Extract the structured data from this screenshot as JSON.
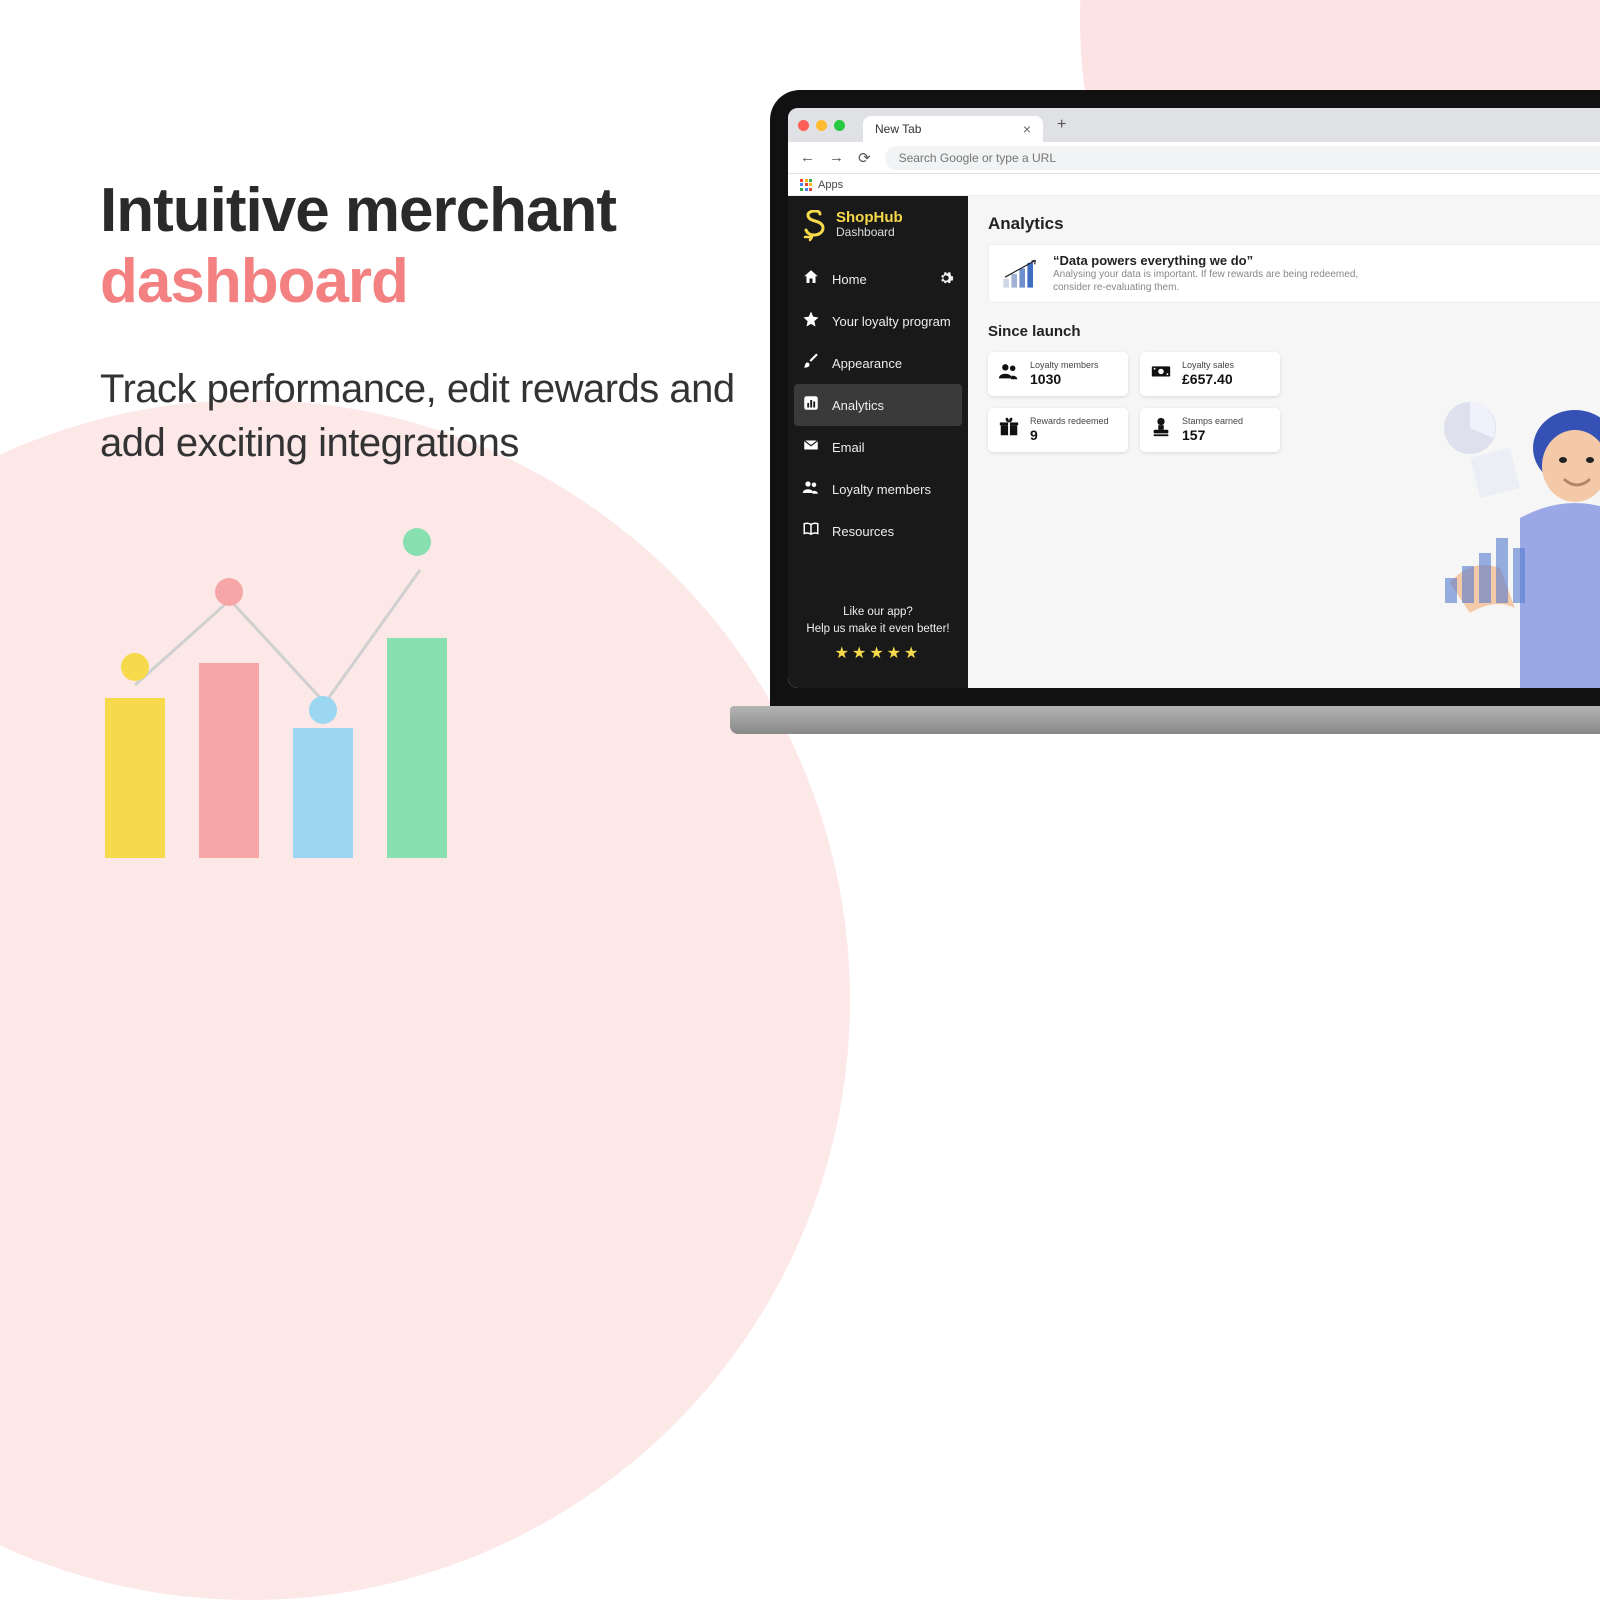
{
  "hero": {
    "title_line1": "Intuitive merchant",
    "title_line2": "dashboard",
    "subtitle": "Track performance, edit rewards and add exciting integrations"
  },
  "browser": {
    "tab_title": "New Tab",
    "new_tab_glyph": "+",
    "url_placeholder": "Search Google or type a URL",
    "bookmarks_label": "Apps"
  },
  "brand": {
    "name": "ShopHub",
    "sub": "Dashboard"
  },
  "sidebar": {
    "items": [
      {
        "icon": "home",
        "label": "Home",
        "has_gear": true
      },
      {
        "icon": "star",
        "label": "Your loyalty program"
      },
      {
        "icon": "brush",
        "label": "Appearance"
      },
      {
        "icon": "chart",
        "label": "Analytics",
        "active": true
      },
      {
        "icon": "mail",
        "label": "Email"
      },
      {
        "icon": "members",
        "label": "Loyalty members"
      },
      {
        "icon": "book",
        "label": "Resources"
      }
    ],
    "rate_line1": "Like our app?",
    "rate_line2": "Help us make it even better!",
    "stars": "★★★★★"
  },
  "analytics": {
    "heading": "Analytics",
    "quote_title": "“Data powers everything we do”",
    "quote_body": "Analysing your data is important. If few rewards are being redeemed, consider re-evaluating them.",
    "section": "Since launch",
    "cards": [
      {
        "icon": "people",
        "label": "Loyalty members",
        "value": "1030"
      },
      {
        "icon": "cash",
        "label": "Loyalty sales",
        "value": "£657.40"
      },
      {
        "icon": "gift",
        "label": "Rewards redeemed",
        "value": "9"
      },
      {
        "icon": "stamp",
        "label": "Stamps earned",
        "value": "157"
      }
    ]
  }
}
